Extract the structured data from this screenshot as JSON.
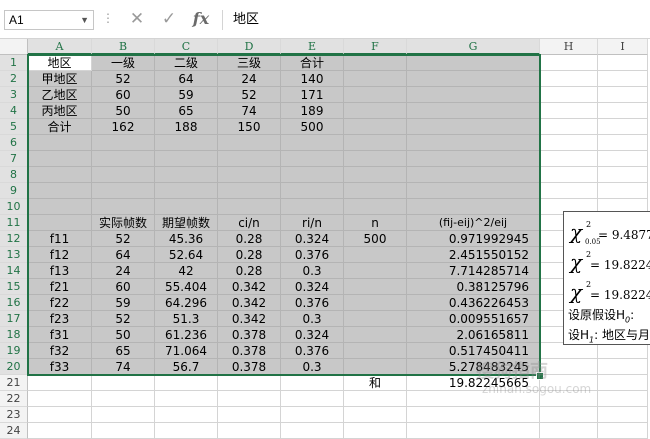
{
  "formula_bar": {
    "name_box": "A1",
    "fx_label": "fx",
    "content": "地区"
  },
  "columns": [
    "A",
    "B",
    "C",
    "D",
    "E",
    "F",
    "G",
    "H",
    "I"
  ],
  "rows": [
    "1",
    "2",
    "3",
    "4",
    "5",
    "6",
    "7",
    "8",
    "9",
    "10",
    "11",
    "12",
    "13",
    "14",
    "15",
    "16",
    "17",
    "18",
    "19",
    "20",
    "21",
    "22",
    "23",
    "24"
  ],
  "cells": {
    "r1": [
      "地区",
      "一级",
      "二级",
      "三级",
      "合计",
      "",
      "",
      "",
      ""
    ],
    "r2": [
      "甲地区",
      "52",
      "64",
      "24",
      "140",
      "",
      "",
      "",
      ""
    ],
    "r3": [
      "乙地区",
      "60",
      "59",
      "52",
      "171",
      "",
      "",
      "",
      ""
    ],
    "r4": [
      "丙地区",
      "50",
      "65",
      "74",
      "189",
      "",
      "",
      "",
      ""
    ],
    "r5": [
      "合计",
      "162",
      "188",
      "150",
      "500",
      "",
      "",
      "",
      ""
    ],
    "r6": [
      "",
      "",
      "",
      "",
      "",
      "",
      "",
      "",
      ""
    ],
    "r7": [
      "",
      "",
      "",
      "",
      "",
      "",
      "",
      "",
      ""
    ],
    "r8": [
      "",
      "",
      "",
      "",
      "",
      "",
      "",
      "",
      ""
    ],
    "r9": [
      "",
      "",
      "",
      "",
      "",
      "",
      "",
      "",
      ""
    ],
    "r10": [
      "",
      "",
      "",
      "",
      "",
      "",
      "",
      "",
      ""
    ],
    "r11": [
      "",
      "实际帧数",
      "期望帧数",
      "ci/n",
      "ri/n",
      "n",
      "(fij-eij)^2/eij",
      "",
      ""
    ],
    "r12": [
      "f11",
      "52",
      "45.36",
      "0.28",
      "0.324",
      "500",
      "0.971992945",
      "",
      ""
    ],
    "r13": [
      "f12",
      "64",
      "52.64",
      "0.28",
      "0.376",
      "",
      "2.451550152",
      "",
      ""
    ],
    "r14": [
      "f13",
      "24",
      "42",
      "0.28",
      "0.3",
      "",
      "7.714285714",
      "",
      ""
    ],
    "r15": [
      "f21",
      "60",
      "55.404",
      "0.342",
      "0.324",
      "",
      "0.38125796",
      "",
      ""
    ],
    "r16": [
      "f22",
      "59",
      "64.296",
      "0.342",
      "0.376",
      "",
      "0.436226453",
      "",
      ""
    ],
    "r17": [
      "f23",
      "52",
      "51.3",
      "0.342",
      "0.3",
      "",
      "0.009551657",
      "",
      ""
    ],
    "r18": [
      "f31",
      "50",
      "61.236",
      "0.378",
      "0.324",
      "",
      "2.06165811",
      "",
      ""
    ],
    "r19": [
      "f32",
      "65",
      "71.064",
      "0.378",
      "0.376",
      "",
      "0.517450411",
      "",
      ""
    ],
    "r20": [
      "f33",
      "74",
      "56.7",
      "0.378",
      "0.3",
      "",
      "5.278483245",
      "",
      ""
    ],
    "r21": [
      "",
      "",
      "",
      "",
      "",
      "和",
      "19.82245665",
      "",
      ""
    ],
    "r22": [
      "",
      "",
      "",
      "",
      "",
      "",
      "",
      "",
      ""
    ],
    "r23": [
      "",
      "",
      "",
      "",
      "",
      "",
      "",
      "",
      ""
    ],
    "r24": [
      "",
      "",
      "",
      "",
      "",
      "",
      "",
      "",
      ""
    ]
  },
  "textbox": {
    "line1_value": "= 9.4877",
    "line1_sub": "0.05",
    "line2_value": "= 19.82245",
    "line3_value": "= 19.82245",
    "hyp1": "设原假设H",
    "hyp1_sub": "0",
    "hyp1_tail": ":",
    "hyp2": "设H",
    "hyp2_sub": "1",
    "hyp2_tail": ":  地区与月"
  },
  "watermark": {
    "line1": "搜狗指南",
    "line2": "zhinan.sogou.com"
  },
  "colors": {
    "shade": "#c8c8c8",
    "select": "#217346"
  }
}
